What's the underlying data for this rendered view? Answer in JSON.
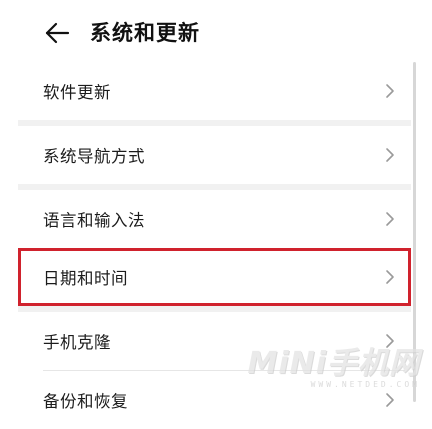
{
  "header": {
    "title": "系统和更新",
    "back_icon": "arrow-left-icon"
  },
  "items": [
    {
      "label": "软件更新"
    },
    {
      "label": "系统导航方式"
    },
    {
      "label": "语言和输入法"
    },
    {
      "label": "日期和时间",
      "highlighted": true
    },
    {
      "label": "手机克隆"
    },
    {
      "label": "备份和恢复"
    }
  ],
  "colors": {
    "highlight_border": "#d0222d",
    "section_gap": "#f1f1f1",
    "text": "#1c1c1c"
  },
  "watermark": {
    "main": "MiNi手机网",
    "sub": "WWW.NETDED.COM"
  }
}
